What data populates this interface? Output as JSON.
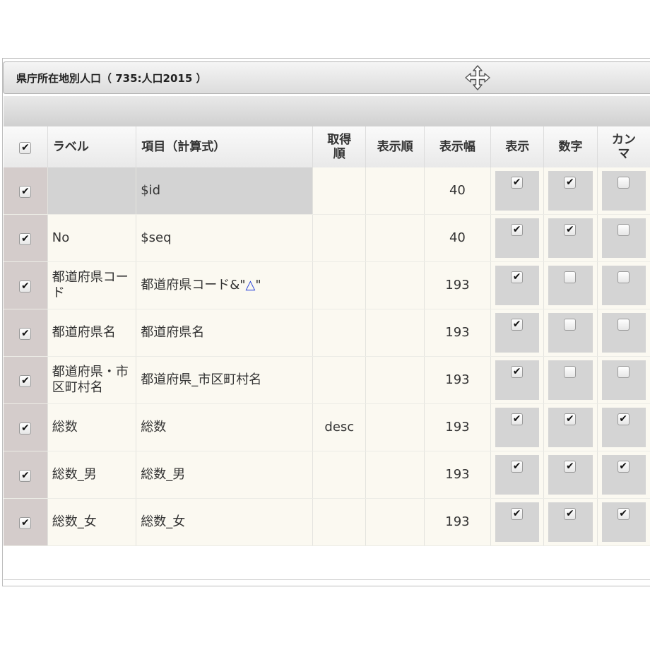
{
  "window": {
    "title": "県庁所在地別人口（ 735:人口2015 ）"
  },
  "table": {
    "headers": {
      "select_all": true,
      "label": "ラベル",
      "item": "項目（計算式）",
      "fetch_order_line1": "取得",
      "fetch_order_line2": "順",
      "display_order": "表示順",
      "display_width": "表示幅",
      "show": "表示",
      "numeric": "数字",
      "comma_line1": "カン",
      "comma_line2": "マ"
    },
    "rows": [
      {
        "selected": true,
        "label": "",
        "item": "$id",
        "fetch": "",
        "order": "",
        "width": "40",
        "show": true,
        "numeric": true,
        "comma": false
      },
      {
        "selected": true,
        "label": "No",
        "item": "$seq",
        "fetch": "",
        "order": "",
        "width": "40",
        "show": true,
        "numeric": true,
        "comma": false
      },
      {
        "selected": true,
        "label": "都道府県コード",
        "item_prefix": "都道府県コード&\"",
        "item_symbol": "△",
        "item_suffix": "\"",
        "fetch": "",
        "order": "",
        "width": "193",
        "show": true,
        "numeric": false,
        "comma": false
      },
      {
        "selected": true,
        "label": "都道府県名",
        "item": "都道府県名",
        "fetch": "",
        "order": "",
        "width": "193",
        "show": true,
        "numeric": false,
        "comma": false
      },
      {
        "selected": true,
        "label": "都道府県・市区町村名",
        "item": "都道府県_市区町村名",
        "fetch": "",
        "order": "",
        "width": "193",
        "show": true,
        "numeric": false,
        "comma": false
      },
      {
        "selected": true,
        "label": "総数",
        "item": "総数",
        "fetch": "desc",
        "order": "",
        "width": "193",
        "show": true,
        "numeric": true,
        "comma": true
      },
      {
        "selected": true,
        "label": "総数_男",
        "item": "総数_男",
        "fetch": "",
        "order": "",
        "width": "193",
        "show": true,
        "numeric": true,
        "comma": true
      },
      {
        "selected": true,
        "label": "総数_女",
        "item": "総数_女",
        "fetch": "",
        "order": "",
        "width": "193",
        "show": true,
        "numeric": true,
        "comma": true
      }
    ]
  },
  "icons": {
    "move": "move-arrows-icon",
    "check": "✔"
  },
  "colors": {
    "selection_column": "#d4cccb",
    "row_background": "#fbf9f1",
    "highlight_row": "#d3d3d3",
    "delta_symbol": "#1a35d8"
  }
}
